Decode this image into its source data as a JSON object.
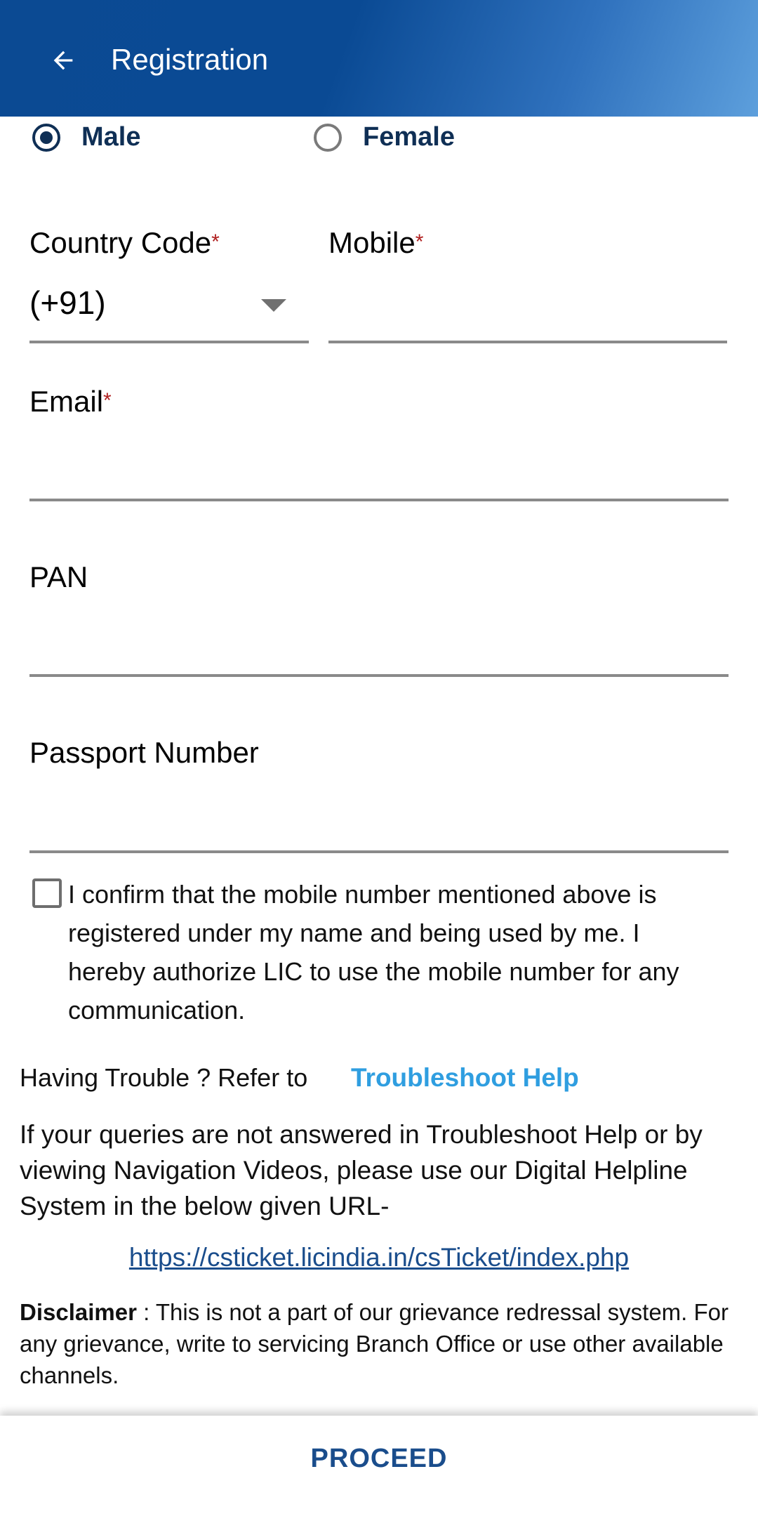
{
  "appbar": {
    "title": "Registration",
    "back_icon": "arrow-left-icon",
    "colors": {
      "start": "#0b4a93",
      "end": "#5d9fdc"
    }
  },
  "gender": {
    "options": [
      {
        "label": "Male",
        "selected": true
      },
      {
        "label": "Female",
        "selected": false
      }
    ]
  },
  "form": {
    "country_code": {
      "label": "Country Code",
      "value": "(+91)",
      "required_mark": "*"
    },
    "mobile": {
      "label": "Mobile",
      "value": "",
      "required_mark": "*"
    },
    "email": {
      "label": "Email",
      "value": "",
      "required_mark": "*"
    },
    "pan": {
      "label": "PAN",
      "value": ""
    },
    "passport": {
      "label": "Passport Number",
      "value": ""
    }
  },
  "confirm": {
    "checked": false,
    "text": "I confirm that the mobile number mentioned above is registered under my name and being used by me. I hereby authorize LIC to use the mobile number for any communication."
  },
  "help": {
    "trouble_text": "Having Trouble ? Refer to",
    "trouble_link": "Troubleshoot Help",
    "queries_text": "If your queries are not answered in Troubleshoot Help or by viewing Navigation Videos, please use our Digital Helpline System in the below given URL-",
    "url": "https://csticket.licindia.in/csTicket/index.php"
  },
  "disclaimer": {
    "label": "Disclaimer",
    "text": " : This is not a part of our grievance redressal system. For any grievance, write to servicing Branch Office or use other available channels."
  },
  "footer": {
    "proceed_label": "PROCEED",
    "accent": "#1a4d8c"
  }
}
